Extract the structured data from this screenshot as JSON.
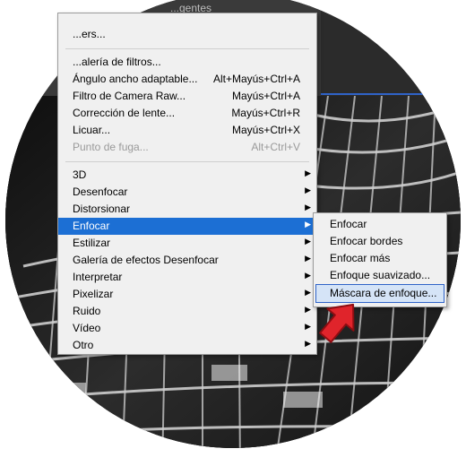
{
  "window": {
    "title_fragment": "...gentes"
  },
  "filter_menu": {
    "items": [
      {
        "label": "...ers...",
        "shortcut": "",
        "submenu": false,
        "disabled": false
      },
      {
        "label": "...alería de filtros...",
        "shortcut": "",
        "submenu": false,
        "disabled": false
      },
      {
        "label": "Ángulo ancho adaptable...",
        "shortcut": "Alt+Mayús+Ctrl+A",
        "submenu": false,
        "disabled": false
      },
      {
        "label": "Filtro de Camera Raw...",
        "shortcut": "Mayús+Ctrl+A",
        "submenu": false,
        "disabled": false
      },
      {
        "label": "Corrección de lente...",
        "shortcut": "Mayús+Ctrl+R",
        "submenu": false,
        "disabled": false
      },
      {
        "label": "Licuar...",
        "shortcut": "Mayús+Ctrl+X",
        "submenu": false,
        "disabled": false
      },
      {
        "label": "Punto de fuga...",
        "shortcut": "Alt+Ctrl+V",
        "submenu": false,
        "disabled": true
      },
      {
        "label": "3D",
        "shortcut": "",
        "submenu": true,
        "disabled": false
      },
      {
        "label": "Desenfocar",
        "shortcut": "",
        "submenu": true,
        "disabled": false
      },
      {
        "label": "Distorsionar",
        "shortcut": "",
        "submenu": true,
        "disabled": false
      },
      {
        "label": "Enfocar",
        "shortcut": "",
        "submenu": true,
        "disabled": false,
        "highlighted": true
      },
      {
        "label": "Estilizar",
        "shortcut": "",
        "submenu": true,
        "disabled": false
      },
      {
        "label": "Galería de efectos Desenfocar",
        "shortcut": "",
        "submenu": true,
        "disabled": false
      },
      {
        "label": "Interpretar",
        "shortcut": "",
        "submenu": true,
        "disabled": false
      },
      {
        "label": "Pixelizar",
        "shortcut": "",
        "submenu": true,
        "disabled": false
      },
      {
        "label": "Ruido",
        "shortcut": "",
        "submenu": true,
        "disabled": false
      },
      {
        "label": "Vídeo",
        "shortcut": "",
        "submenu": true,
        "disabled": false
      },
      {
        "label": "Otro",
        "shortcut": "",
        "submenu": true,
        "disabled": false
      }
    ]
  },
  "enfocar_submenu": {
    "items": [
      {
        "label": "Enfocar"
      },
      {
        "label": "Enfocar bordes"
      },
      {
        "label": "Enfocar más"
      },
      {
        "label": "Enfoque suavizado..."
      },
      {
        "label": "Máscara de enfoque...",
        "selected": true
      }
    ]
  },
  "icons": {
    "submenu_arrow": "triangle-right",
    "pointer": "red-arrow-icon"
  },
  "colors": {
    "highlight": "#1c6fd4",
    "selection_border": "#2f63c8",
    "pointer": "#e0242b"
  }
}
